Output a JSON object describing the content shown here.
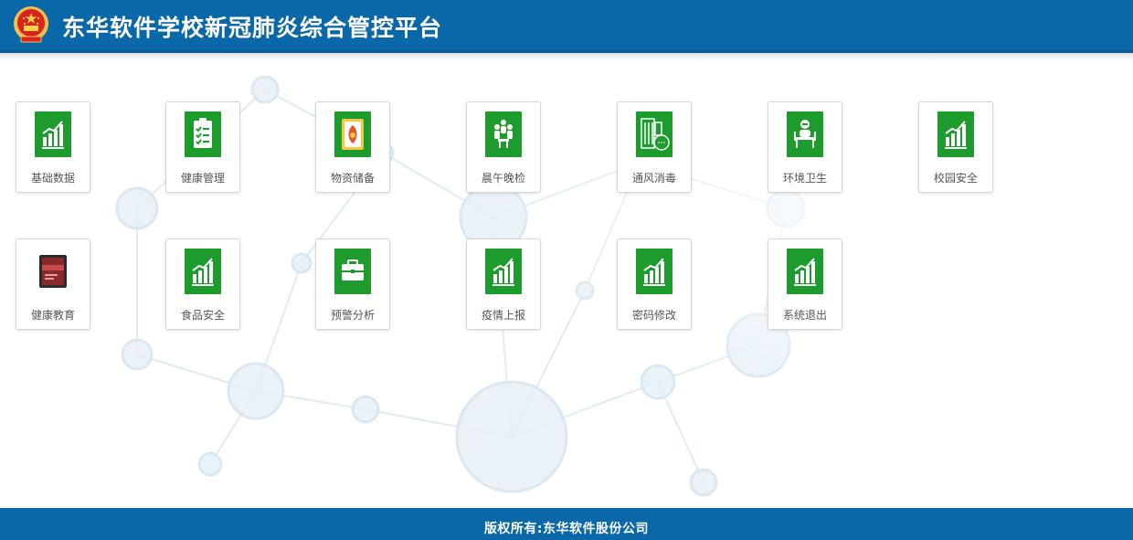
{
  "header": {
    "title": "东华软件学校新冠肺炎综合管控平台",
    "emblem_icon": "national-emblem-icon"
  },
  "tiles": [
    {
      "label": "基础数据",
      "icon": "bar-chart-icon"
    },
    {
      "label": "健康管理",
      "icon": "clipboard-checklist-icon"
    },
    {
      "label": "物资储备",
      "icon": "supplies-icon"
    },
    {
      "label": "晨午晚检",
      "icon": "people-meeting-icon"
    },
    {
      "label": "通风消毒",
      "icon": "building-ventilation-icon"
    },
    {
      "label": "环境卫生",
      "icon": "person-desk-icon"
    },
    {
      "label": "校园安全",
      "icon": "bar-chart-icon"
    },
    {
      "label": "健康教育",
      "icon": "screen-icon"
    },
    {
      "label": "食品安全",
      "icon": "bar-chart-icon"
    },
    {
      "label": "预警分析",
      "icon": "briefcase-icon"
    },
    {
      "label": "疫情上报",
      "icon": "bar-chart-icon"
    },
    {
      "label": "密码修改",
      "icon": "bar-chart-icon"
    },
    {
      "label": "系统退出",
      "icon": "bar-chart-icon"
    }
  ],
  "footer": {
    "copyright": "版权所有:东华软件股份公司"
  },
  "colors": {
    "header_bg": "#0a68a8",
    "icon_green": "#1d9b2c",
    "footer_bg": "#0a68a8"
  }
}
